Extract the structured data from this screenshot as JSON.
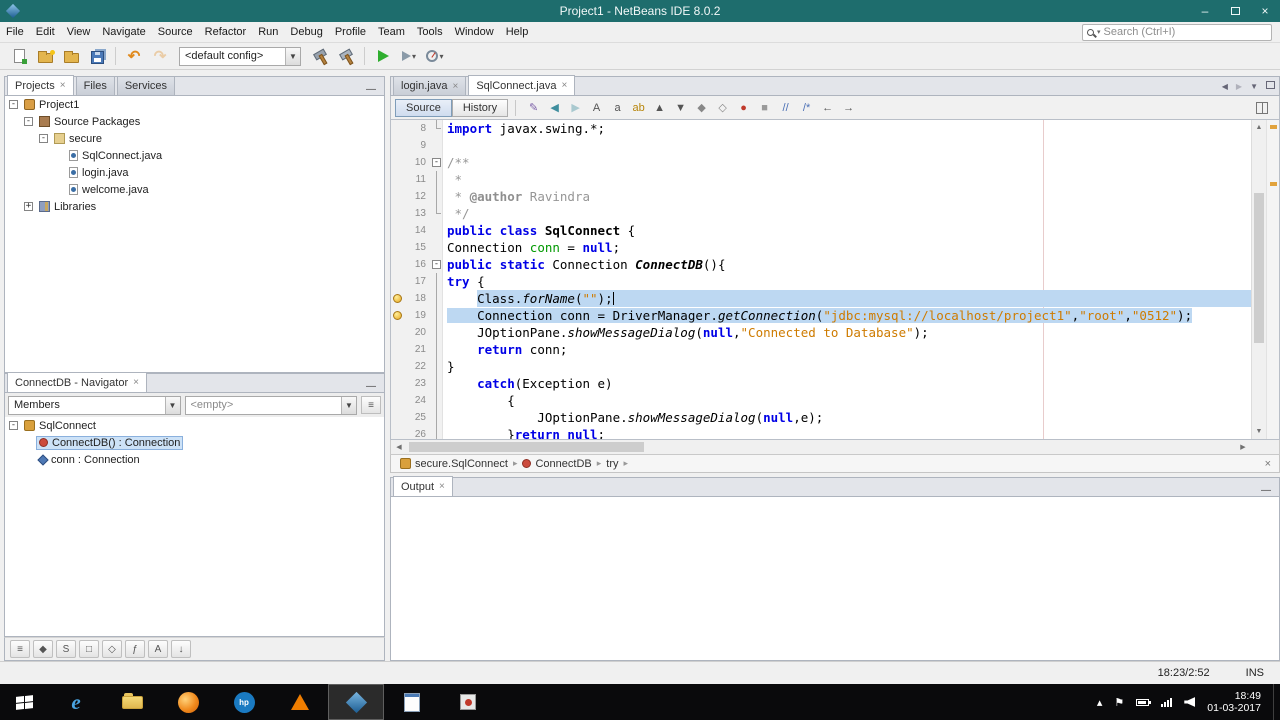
{
  "colors": {
    "titlebar": "#1e6d6d",
    "selection": "#bdd8f2",
    "keyword": "#0000e6",
    "string": "#ce7b00",
    "comment": "#969696",
    "field": "#009900",
    "run_button": "#2fae2f"
  },
  "window": {
    "title": "Project1 - NetBeans IDE 8.0.2"
  },
  "menu": {
    "items": [
      "File",
      "Edit",
      "View",
      "Navigate",
      "Source",
      "Refactor",
      "Run",
      "Debug",
      "Profile",
      "Team",
      "Tools",
      "Window",
      "Help"
    ],
    "search_placeholder": "Search (Ctrl+I)"
  },
  "toolbar": {
    "config_value": "<default config>",
    "groups_a": [
      [
        "new-file-icon",
        "new-project-icon",
        "open-project-icon",
        "save-all-icon"
      ],
      [
        "undo-icon",
        "redo-icon"
      ]
    ],
    "groups_b": [
      [
        "build-icon",
        "clean-build-icon"
      ],
      [
        "run-icon",
        "debug-icon",
        "profile-icon"
      ]
    ]
  },
  "explorer": {
    "tabs": [
      {
        "label": "Projects",
        "active": true,
        "closable": true
      },
      {
        "label": "Files"
      },
      {
        "label": "Services"
      }
    ],
    "tree": [
      {
        "label": "Project1",
        "depth": 0,
        "expander": "minus",
        "icon": "project-icon"
      },
      {
        "label": "Source Packages",
        "depth": 1,
        "expander": "minus",
        "icon": "packages-icon"
      },
      {
        "label": "secure",
        "depth": 2,
        "expander": "minus",
        "icon": "package-icon"
      },
      {
        "label": "SqlConnect.java",
        "depth": 3,
        "icon": "java-file-icon"
      },
      {
        "label": "login.java",
        "depth": 3,
        "icon": "java-file-icon"
      },
      {
        "label": "welcome.java",
        "depth": 3,
        "icon": "java-file-icon"
      },
      {
        "label": "Libraries",
        "depth": 1,
        "expander": "plus",
        "icon": "libraries-icon"
      }
    ]
  },
  "navigator": {
    "title": "ConnectDB - Navigator",
    "filter_left": "Members",
    "filter_right": "<empty>",
    "tree": [
      {
        "label": "SqlConnect",
        "depth": 0,
        "expander": "minus",
        "icon": "class-icon"
      },
      {
        "label": "ConnectDB() : Connection",
        "depth": 1,
        "icon": "method-icon",
        "selected": true
      },
      {
        "label": "conn : Connection",
        "depth": 1,
        "icon": "field-icon"
      }
    ],
    "filter_buttons": [
      {
        "name": "show-inherited-icon",
        "glyph": "≡"
      },
      {
        "name": "show-fields-icon",
        "glyph": "◆"
      },
      {
        "name": "show-static-icon",
        "glyph": "S"
      },
      {
        "name": "show-non-public-icon",
        "glyph": "□"
      },
      {
        "name": "show-inner-classes-icon",
        "glyph": "◇"
      },
      {
        "name": "fully-qualified-icon",
        "glyph": "ƒ"
      },
      {
        "name": "sort-alpha-icon",
        "glyph": "A"
      },
      {
        "name": "sort-source-icon",
        "glyph": "↓"
      }
    ]
  },
  "editor": {
    "tabs": [
      {
        "label": "login.java"
      },
      {
        "label": "SqlConnect.java",
        "active": true
      }
    ],
    "views": [
      {
        "label": "Source",
        "active": true
      },
      {
        "label": "History"
      }
    ],
    "toolbar_icons": [
      {
        "name": "last-edit-icon",
        "glyph": "✎",
        "color": "#7b5fa8"
      },
      {
        "name": "back-icon",
        "glyph": "◀",
        "color": "#3f8e9e"
      },
      {
        "name": "forward-icon",
        "glyph": "▶",
        "color": "#3f8e9e",
        "disabled": true
      },
      {
        "name": "find-selection-icon",
        "glyph": "A",
        "color": "#555555"
      },
      {
        "name": "find-occurrence-icon",
        "glyph": "a",
        "color": "#555555"
      },
      {
        "name": "toggle-highlight-icon",
        "glyph": "ab",
        "color": "#b8860b"
      },
      {
        "name": "prev-occurrence-icon",
        "glyph": "▲",
        "color": "#555555"
      },
      {
        "name": "next-occurrence-icon",
        "glyph": "▼",
        "color": "#555555"
      },
      {
        "name": "toggle-bookmark-icon",
        "glyph": "◆",
        "color": "#888888"
      },
      {
        "name": "next-bookmark-icon",
        "glyph": "◇",
        "color": "#888888"
      },
      {
        "name": "start-macro-icon",
        "glyph": "●",
        "color": "#c0392b"
      },
      {
        "name": "stop-macro-icon",
        "glyph": "■",
        "color": "#9a9a9a"
      },
      {
        "name": "comment-icon",
        "glyph": "//",
        "color": "#4a6fb5"
      },
      {
        "name": "uncomment-icon",
        "glyph": "/*",
        "color": "#4a6fb5"
      },
      {
        "name": "shift-left-icon",
        "glyph": "←",
        "color": "#555555"
      },
      {
        "name": "shift-right-icon",
        "glyph": "→",
        "color": "#555555"
      }
    ],
    "lines": [
      {
        "n": 8,
        "fold": "end",
        "segs": [
          [
            "k",
            "import"
          ],
          [
            "p",
            " javax.swing.*;"
          ]
        ]
      },
      {
        "n": 9,
        "segs": []
      },
      {
        "n": 10,
        "fold": "open",
        "segs": [
          [
            "c",
            "/**"
          ]
        ]
      },
      {
        "n": 11,
        "fold": "line",
        "segs": [
          [
            "c",
            " *"
          ]
        ]
      },
      {
        "n": 12,
        "fold": "line",
        "segs": [
          [
            "c",
            " * "
          ],
          [
            "cb",
            "@author"
          ],
          [
            "c",
            " Ravindra"
          ]
        ]
      },
      {
        "n": 13,
        "fold": "end",
        "segs": [
          [
            "c",
            " */"
          ]
        ]
      },
      {
        "n": 14,
        "segs": [
          [
            "k",
            "public"
          ],
          [
            "p",
            " "
          ],
          [
            "k",
            "class"
          ],
          [
            "p",
            " "
          ],
          [
            "d",
            "SqlConnect"
          ],
          [
            "p",
            " {"
          ]
        ]
      },
      {
        "n": 15,
        "segs": [
          [
            "p",
            "Connection "
          ],
          [
            "f",
            "conn"
          ],
          [
            "p",
            " = "
          ],
          [
            "k",
            "null"
          ],
          [
            "p",
            ";"
          ]
        ]
      },
      {
        "n": 16,
        "fold": "open",
        "segs": [
          [
            "k",
            "public"
          ],
          [
            "p",
            " "
          ],
          [
            "k",
            "static"
          ],
          [
            "p",
            " Connection "
          ],
          [
            "di",
            "ConnectDB"
          ],
          [
            "p",
            "(){"
          ]
        ]
      },
      {
        "n": 17,
        "fold": "line",
        "segs": [
          [
            "k",
            "try"
          ],
          [
            "p",
            " {"
          ]
        ]
      },
      {
        "n": 18,
        "fold": "line",
        "glyph": "bulb",
        "hl": "tail",
        "segs": [
          [
            "p",
            "    "
          ],
          [
            "p",
            "Class."
          ],
          [
            "m",
            "forName"
          ],
          [
            "p",
            "("
          ],
          [
            "s",
            "\"\""
          ],
          [
            "p",
            ");"
          ],
          [
            "caret",
            ""
          ]
        ]
      },
      {
        "n": 19,
        "fold": "line",
        "glyph": "bulb",
        "hl": "line",
        "segs": [
          [
            "p",
            "    Connection conn = DriverManager."
          ],
          [
            "m",
            "getConnection"
          ],
          [
            "p",
            "("
          ],
          [
            "s",
            "\"jdbc:mysql://localhost/project1\""
          ],
          [
            "p",
            ","
          ],
          [
            "s",
            "\"root\""
          ],
          [
            "p",
            ","
          ],
          [
            "s",
            "\"0512\""
          ],
          [
            "p",
            ");"
          ]
        ]
      },
      {
        "n": 20,
        "fold": "line",
        "segs": [
          [
            "p",
            "    JOptionPane."
          ],
          [
            "m",
            "showMessageDialog"
          ],
          [
            "p",
            "("
          ],
          [
            "k",
            "null"
          ],
          [
            "p",
            ","
          ],
          [
            "s",
            "\"Connected to Database\""
          ],
          [
            "p",
            ");"
          ]
        ]
      },
      {
        "n": 21,
        "fold": "line",
        "segs": [
          [
            "p",
            "    "
          ],
          [
            "k",
            "return"
          ],
          [
            "p",
            " conn;"
          ]
        ]
      },
      {
        "n": 22,
        "fold": "line",
        "segs": [
          [
            "p",
            "}"
          ]
        ]
      },
      {
        "n": 23,
        "fold": "line",
        "segs": [
          [
            "p",
            "    "
          ],
          [
            "k",
            "catch"
          ],
          [
            "p",
            "(Exception e)"
          ]
        ]
      },
      {
        "n": 24,
        "fold": "line",
        "segs": [
          [
            "p",
            "        {"
          ]
        ]
      },
      {
        "n": 25,
        "fold": "line",
        "segs": [
          [
            "p",
            "            JOptionPane."
          ],
          [
            "m",
            "showMessageDialog"
          ],
          [
            "p",
            "("
          ],
          [
            "k",
            "null"
          ],
          [
            "p",
            ",e);"
          ]
        ]
      },
      {
        "n": 26,
        "fold": "line",
        "segs": [
          [
            "p",
            "        }"
          ],
          [
            "k",
            "return"
          ],
          [
            "p",
            " "
          ],
          [
            "k",
            "null"
          ],
          [
            "p",
            ";"
          ]
        ]
      }
    ],
    "breadcrumb": [
      {
        "label": "secure.SqlConnect",
        "icon": "class-icon"
      },
      {
        "label": "ConnectDB",
        "icon": "method-icon"
      },
      {
        "label": "try",
        "icon": null
      }
    ]
  },
  "output": {
    "tab": "Output"
  },
  "status": {
    "caret_position": "18:23/2:52",
    "insert_mode": "INS"
  },
  "taskbar": {
    "time": "18:49",
    "date": "01-03-2017",
    "apps": [
      {
        "name": "ie-icon",
        "glyph": "e"
      },
      {
        "name": "explorer-icon"
      },
      {
        "name": "firefox-icon"
      },
      {
        "name": "hp-icon",
        "glyph": "hp"
      },
      {
        "name": "vlc-icon"
      },
      {
        "name": "netbeans-icon",
        "active": true
      },
      {
        "name": "notepad-icon"
      },
      {
        "name": "paint-icon"
      }
    ],
    "tray": [
      {
        "name": "hidden-icons-chevron",
        "glyph": "▴"
      },
      {
        "name": "action-center-icon",
        "glyph": "⚑"
      },
      {
        "name": "battery-icon"
      },
      {
        "name": "network-icon"
      },
      {
        "name": "volume-icon"
      }
    ]
  }
}
